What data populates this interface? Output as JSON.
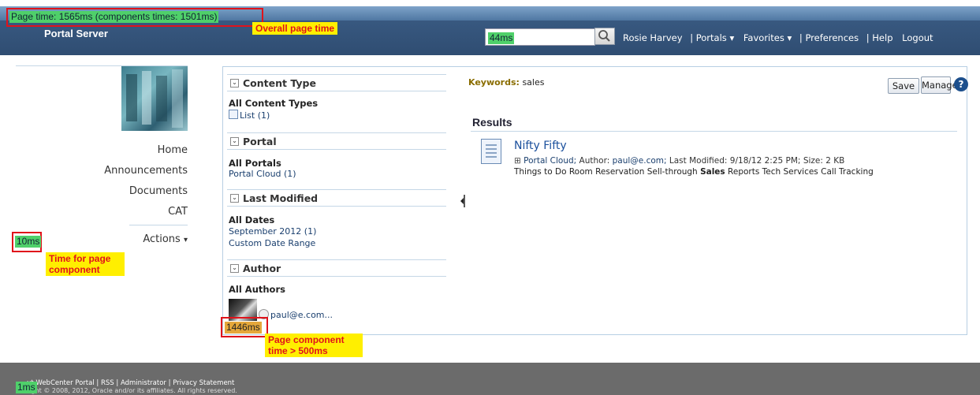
{
  "header": {
    "title": "Portal Server",
    "search_timing": "44ms",
    "user": "Rosie Harvey",
    "portals": "Portals",
    "favorites": "Favorites",
    "preferences": "Preferences",
    "help": "Help",
    "logout": "Logout",
    "separator": "|"
  },
  "overlays": {
    "page_time": "Page time: 1565ms (components times: 1501ms)",
    "overall_label": "Overall page time",
    "nav_timing": "10ms",
    "component_label_1": "Time for page",
    "component_label_2": "component",
    "author_timing": "1446ms",
    "slow_label_1": "Page component",
    "slow_label_2": "time > 500ms",
    "footer_timing": "1ms"
  },
  "nav": {
    "items": [
      "Home",
      "Announcements",
      "Documents",
      "CAT"
    ],
    "actions": "Actions"
  },
  "facets": {
    "content_type": {
      "header": "Content Type",
      "title": "All Content Types",
      "items": [
        "List (1)"
      ]
    },
    "portal": {
      "header": "Portal",
      "title": "All Portals",
      "items": [
        "Portal Cloud (1)"
      ]
    },
    "last_modified": {
      "header": "Last Modified",
      "title": "All Dates",
      "items": [
        "September 2012 (1)",
        "Custom Date Range"
      ]
    },
    "author": {
      "header": "Author",
      "title": "All Authors",
      "items": [
        "paul@e.com..."
      ]
    }
  },
  "search": {
    "keywords_label": "Keywords:",
    "keywords_value": "sales",
    "save": "Save",
    "manage": "Manage",
    "help": "?",
    "results_title": "Results"
  },
  "result": {
    "title": "Nifty Fifty",
    "location": "Portal Cloud;",
    "author_label": "Author:",
    "author": "paul@e.com;",
    "modified_label": "Last Modified:",
    "modified": "9/18/12 2:25 PM;",
    "size_label": "Size:",
    "size": "2 KB",
    "tags_before": "Things to Do Room Reservation Sell-through",
    "tags_bold": "Sales",
    "tags_after": "Reports Tech Services Call Tracking"
  },
  "footer": {
    "line1_prefix": "ut WebCenter Portal",
    "rss": "RSS",
    "administrator": "Administrator",
    "privacy": "Privacy Statement",
    "line2": "right © 2008, 2012, Oracle and/or its affiliates. All rights reserved."
  },
  "colors": {
    "header": "#2f4d72",
    "timing_green": "#4fd06a",
    "timing_orange": "#e5a73a",
    "callout_red": "#e0131b",
    "callout_yellow": "#ffef00"
  }
}
